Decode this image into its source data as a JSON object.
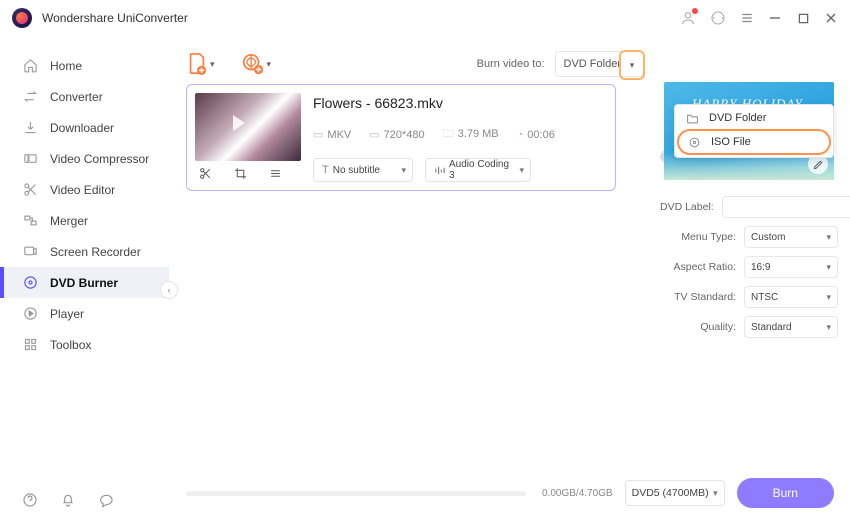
{
  "app": {
    "title": "Wondershare UniConverter"
  },
  "sidebar": {
    "items": [
      {
        "label": "Home"
      },
      {
        "label": "Converter"
      },
      {
        "label": "Downloader"
      },
      {
        "label": "Video Compressor"
      },
      {
        "label": "Video Editor"
      },
      {
        "label": "Merger"
      },
      {
        "label": "Screen Recorder"
      },
      {
        "label": "DVD Burner"
      },
      {
        "label": "Player"
      },
      {
        "label": "Toolbox"
      }
    ],
    "active_index": 7
  },
  "toolbar": {
    "burn_to_label": "Burn video to:",
    "burn_to_value": "DVD Folder",
    "dropdown": {
      "opt1": "DVD Folder",
      "opt2": "ISO File"
    }
  },
  "video": {
    "filename": "Flowers - 66823.mkv",
    "format": "MKV",
    "resolution": "720*480",
    "filesize": "3.79 MB",
    "duration": "00:06",
    "subtitle_prefix": "T",
    "subtitle_value": "No subtitle",
    "audio_value": "Audio Coding 3"
  },
  "template": {
    "banner": "HAPPY HOLIDAY"
  },
  "form": {
    "dvd_label": "DVD Label:",
    "menu_type_label": "Menu Type:",
    "menu_type_value": "Custom",
    "aspect_label": "Aspect Ratio:",
    "aspect_value": "16:9",
    "tv_label": "TV Standard:",
    "tv_value": "NTSC",
    "quality_label": "Quality:",
    "quality_value": "Standard"
  },
  "bottom": {
    "size": "0.00GB/4.70GB",
    "disc": "DVD5 (4700MB)",
    "burn": "Burn"
  }
}
